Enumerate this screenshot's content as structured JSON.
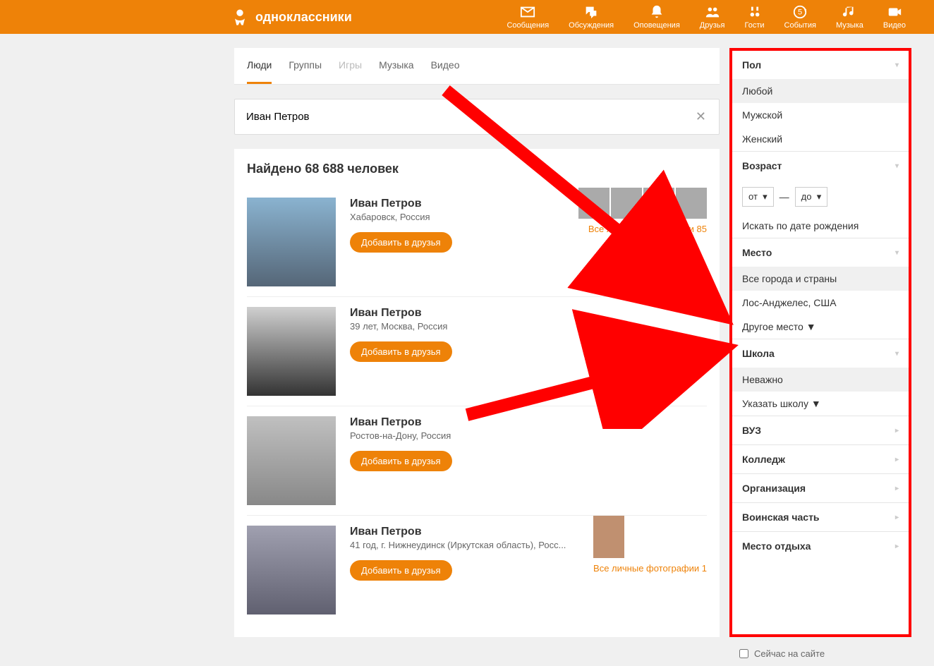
{
  "header": {
    "brand": "одноклассники",
    "nav": {
      "messages": "Сообщения",
      "discussions": "Обсуждения",
      "notifications": "Оповещения",
      "friends": "Друзья",
      "guests": "Гости",
      "events": "События",
      "music": "Музыка",
      "video": "Видео"
    }
  },
  "tabs": {
    "people": "Люди",
    "groups": "Группы",
    "games": "Игры",
    "music": "Музыка",
    "video": "Видео"
  },
  "search": {
    "value": "Иван Петров"
  },
  "results": {
    "title": "Найдено 68 688 человек",
    "add_friend_label": "Добавить в друзья",
    "people": [
      {
        "name": "Иван Петров",
        "location": "Хабаровск, Россия",
        "photos_link": "Все личные фотографии 85",
        "has_thumbs": true
      },
      {
        "name": "Иван Петров",
        "location": "39 лет, Москва, Россия",
        "photos_link": "",
        "has_thumbs": false
      },
      {
        "name": "Иван Петров",
        "location": "Ростов-на-Дону, Россия",
        "photos_link": "",
        "has_thumbs": false
      },
      {
        "name": "Иван Петров",
        "location": "41 год, г. Нижнеудинск (Иркутская область), Росс...",
        "photos_link": "Все личные фотографии 1",
        "has_thumbs": false,
        "side_thumb": true
      }
    ]
  },
  "filters": {
    "gender": {
      "title": "Пол",
      "any": "Любой",
      "male": "Мужской",
      "female": "Женский"
    },
    "age": {
      "title": "Возраст",
      "from": "от",
      "to": "до",
      "dash": "—",
      "birthday": "Искать по дате рождения"
    },
    "place": {
      "title": "Место",
      "all": "Все города и страны",
      "option1": "Лос-Анджелес, США",
      "other": "Другое место ▼"
    },
    "school": {
      "title": "Школа",
      "any": "Неважно",
      "specify": "Указать школу ▼"
    },
    "university": {
      "title": "ВУЗ"
    },
    "college": {
      "title": "Колледж"
    },
    "organization": {
      "title": "Организация"
    },
    "military": {
      "title": "Воинская часть"
    },
    "vacation": {
      "title": "Место отдыха"
    },
    "online_now": "Сейчас на сайте"
  }
}
